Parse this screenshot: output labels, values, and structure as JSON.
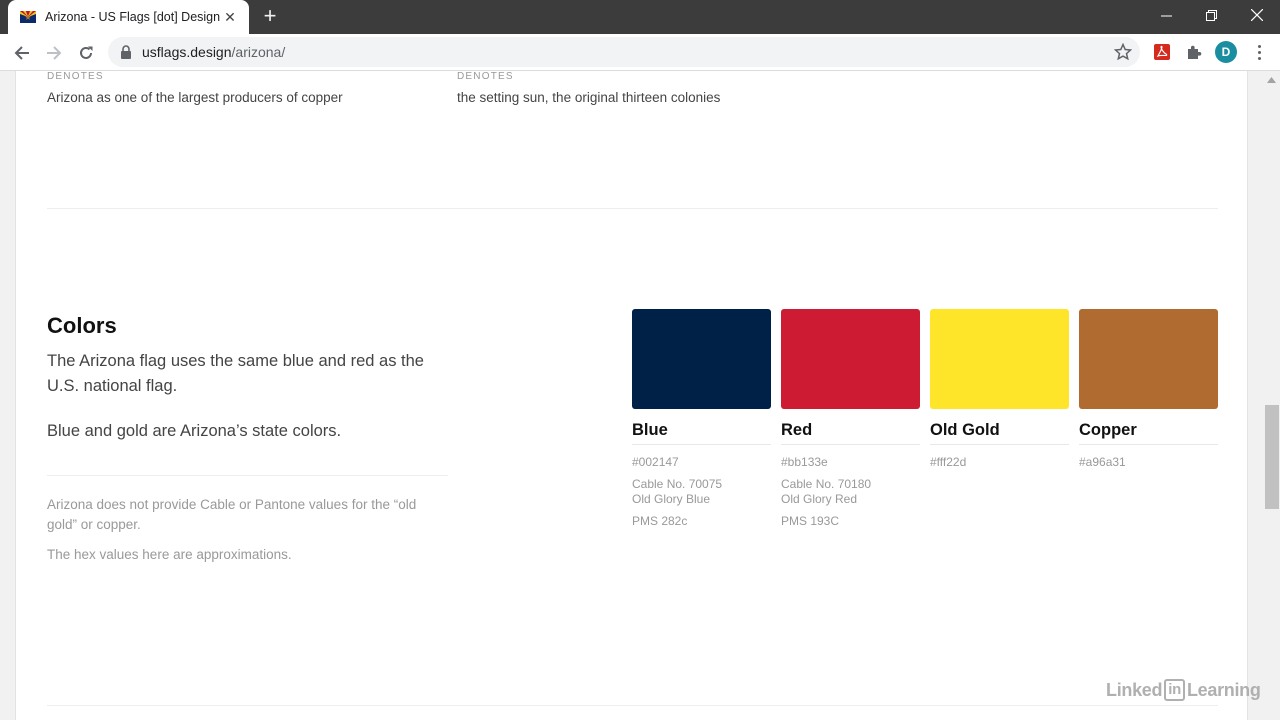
{
  "browser": {
    "tab_title": "Arizona - US Flags [dot] Design",
    "url_host": "usflags.design",
    "url_path": "/arizona/",
    "profile_initial": "D"
  },
  "denotes": [
    {
      "label": "DENOTES",
      "text": "Arizona as one of the largest producers of copper"
    },
    {
      "label": "DENOTES",
      "text": "the setting sun, the original thirteen colonies"
    }
  ],
  "colors_section": {
    "title": "Colors",
    "paragraph1": "The Arizona flag uses the same blue and red as the U.S. national flag.",
    "paragraph2": "Blue and gold are Arizona’s state colors.",
    "note1": "Arizona does not provide Cable or Pantone values for the “old gold” or copper.",
    "note2": "The hex values here are approximations."
  },
  "swatches": [
    {
      "name": "Blue",
      "hex": "#002147",
      "color": "#002147",
      "cable": "Cable No. 70075",
      "cable_name": "Old Glory Blue",
      "pms": "PMS 282c"
    },
    {
      "name": "Red",
      "hex": "#bb133e",
      "color": "#cc1b32",
      "cable": "Cable No. 70180",
      "cable_name": "Old Glory Red",
      "pms": "PMS 193C"
    },
    {
      "name": "Old Gold",
      "hex": "#fff22d",
      "color": "#ffe52a"
    },
    {
      "name": "Copper",
      "hex": "#a96a31",
      "color": "#b06c30"
    }
  ],
  "watermark": {
    "left": "Linked",
    "box": "in",
    "right": "Learning"
  }
}
